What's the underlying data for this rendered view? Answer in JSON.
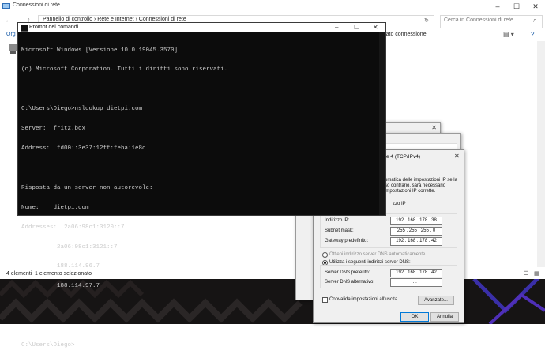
{
  "explorer": {
    "title": "Connessioni di rete",
    "address": "Pannello di controllo  ›  Rete e Internet  ›  Connessioni di rete",
    "search_placeholder": "Cerca in Connessioni di rete",
    "toolbar_left": "Org",
    "status_column": "Stato connessione",
    "status_items": "4 elementi",
    "status_selected": "1 elemento selezionato"
  },
  "cmd": {
    "title": "Prompt dei comandi",
    "lines": [
      "Microsoft Windows [Versione 10.0.19045.3570]",
      "(c) Microsoft Corporation. Tutti i diritti sono riservati.",
      "",
      "C:\\Users\\Diego>nslookup dietpi.com",
      "Server:  fritz.box",
      "Address:  fd00::3e37:12ff:feba:1e8c",
      "",
      "Risposta da un server non autorevole:",
      "Nome:    dietpi.com",
      "Addresses:  2a06:98c1:3120::7",
      "          2a06:98c1:3121::7",
      "          188.114.96.7",
      "          188.114.97.7",
      "",
      "",
      "C:\\Users\\Diego>"
    ]
  },
  "ipv4": {
    "title": "e 4 (TCP/IPv4)",
    "intro": [
      "omatica delle impostazioni IP se la",
      "so contrario, sarà necessario",
      "impostazioni IP corrette."
    ],
    "auto_ip_partial": "zzo IP",
    "ip_label": "Indirizzo IP:",
    "ip_value": "192 . 168 . 178 . 38",
    "mask_label": "Subnet mask:",
    "mask_value": "255 . 255 . 255 . 0",
    "gw_label": "Gateway predefinito:",
    "gw_value": "192 . 168 . 178 . 42",
    "dns_auto_label": "Ottieni indirizzo server DNS automaticamente",
    "dns_manual_label": "Utilizza i seguenti indirizzi server DNS:",
    "dns_pref_label": "Server DNS preferito:",
    "dns_pref_value": "192 . 168 . 178 . 42",
    "dns_alt_label": "Server DNS alternativo:",
    "dns_alt_value": ".     .     .",
    "validate_label": "Convalida impostazioni all'uscita",
    "advanced_label": "Avanzate...",
    "ok_label": "OK",
    "cancel_label": "Annulla"
  }
}
